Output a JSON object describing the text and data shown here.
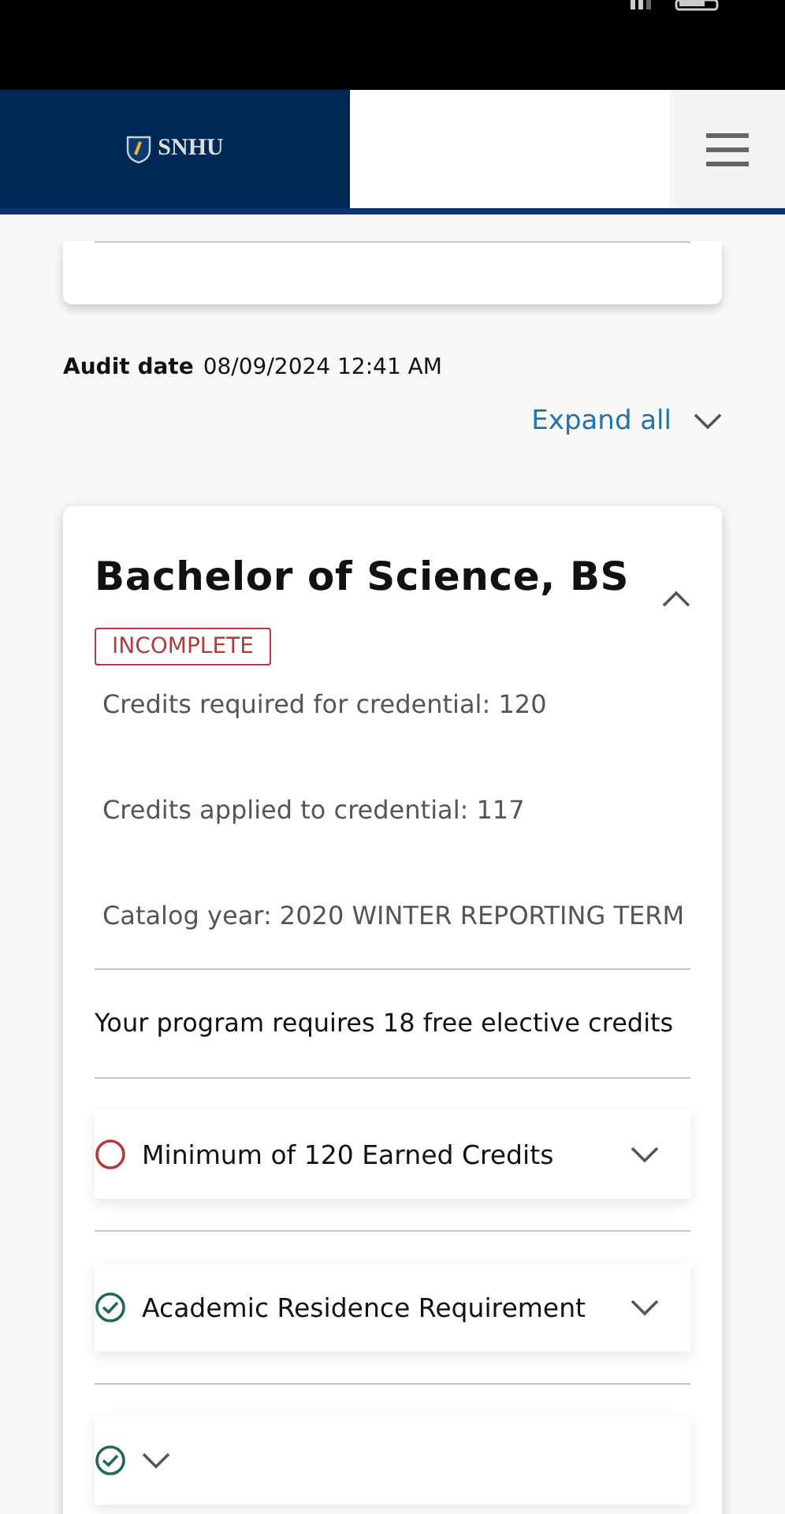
{
  "header": {
    "logo": "SNHU"
  },
  "audit": {
    "label": "Audit date",
    "value": "08/09/2024 12:41 AM"
  },
  "expand_all": {
    "label": "Expand all"
  },
  "credential": {
    "title": "Bachelor of Science, BS",
    "expanded": true,
    "status": "INCOMPLETE",
    "facts": [
      "Credits required for credential:  120",
      "Credits applied to credential:  117",
      "Catalog year:  2020 WINTER REPORTING TERM"
    ],
    "note": "Your program requires 18 free elective credits",
    "requirements": [
      {
        "label": "Minimum of 120 Earned Credits",
        "met": false,
        "expanded": false
      },
      {
        "label": "Academic Residence Requirement",
        "met": true,
        "expanded": false
      },
      {
        "met": true,
        "expanded": false
      }
    ]
  }
}
